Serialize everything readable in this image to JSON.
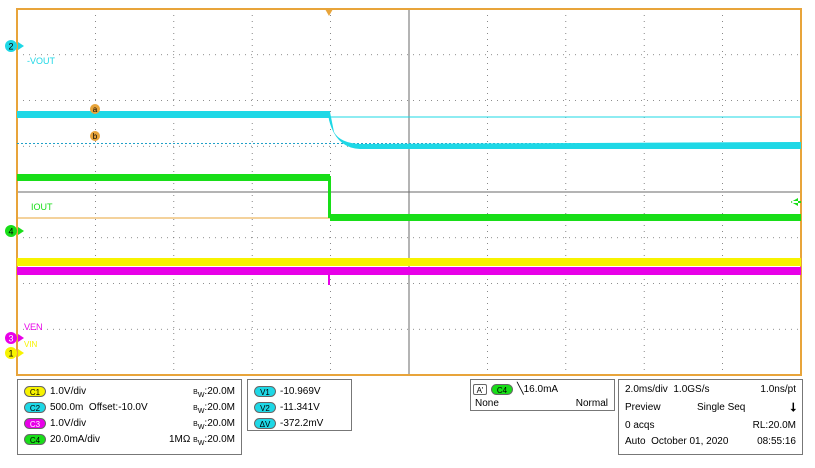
{
  "colors": {
    "c1": "#f7f300",
    "c2": "#1ed8e6",
    "c3": "#e800e8",
    "c4": "#18de18",
    "cursor": "#e8a040",
    "grid": "#6a6a6a",
    "frame": "#e8a43a"
  },
  "labels": {
    "vout": "-VOUT",
    "iout": "IOUT",
    "ven": "VEN",
    "c1": "VIN"
  },
  "markers": {
    "ch2": "2",
    "ch4": "4",
    "ch3": "3",
    "ch1": "1",
    "cur_a": "a",
    "cur_b": "b"
  },
  "channels": [
    {
      "badge": "C1",
      "color": "#f7f300",
      "scale": "1.0V/div",
      "extra": "",
      "bw_label": "W",
      "bw": ":20.0M"
    },
    {
      "badge": "C2",
      "color": "#1ed8e6",
      "scale": "500.0m",
      "extra": "Offset:-10.0V",
      "bw_label": "W",
      "bw": ":20.0M"
    },
    {
      "badge": "C3",
      "color": "#e800e8",
      "scale": "1.0V/div",
      "extra": "",
      "bw_label": "W",
      "bw": ":20.0M"
    },
    {
      "badge": "C4",
      "color": "#18de18",
      "scale": "20.0mA/div",
      "extra": "1MΩ",
      "bw_label": "W",
      "bw": ":20.0M"
    }
  ],
  "cursors": [
    {
      "badge": "V1",
      "value": "-10.969V"
    },
    {
      "badge": "V2",
      "value": "-11.341V"
    },
    {
      "badge": "ΔV",
      "value": "-372.2mV"
    }
  ],
  "trigger": {
    "mode_badge": "A'",
    "source_badge": "C4",
    "slope": "⌐",
    "level": "16.0mA",
    "coupling": "None",
    "type": "Normal"
  },
  "acquisition": {
    "timebase": "2.0ms/div",
    "sample_rate": "1.0GS/s",
    "resolution": "1.0ns/pt",
    "status": "Preview",
    "mode": "Single Seq",
    "acqs": "0 acqs",
    "record": "RL:20.0M",
    "trig_mode": "Auto",
    "date": "October 01, 2020",
    "time": "08:55:16"
  }
}
